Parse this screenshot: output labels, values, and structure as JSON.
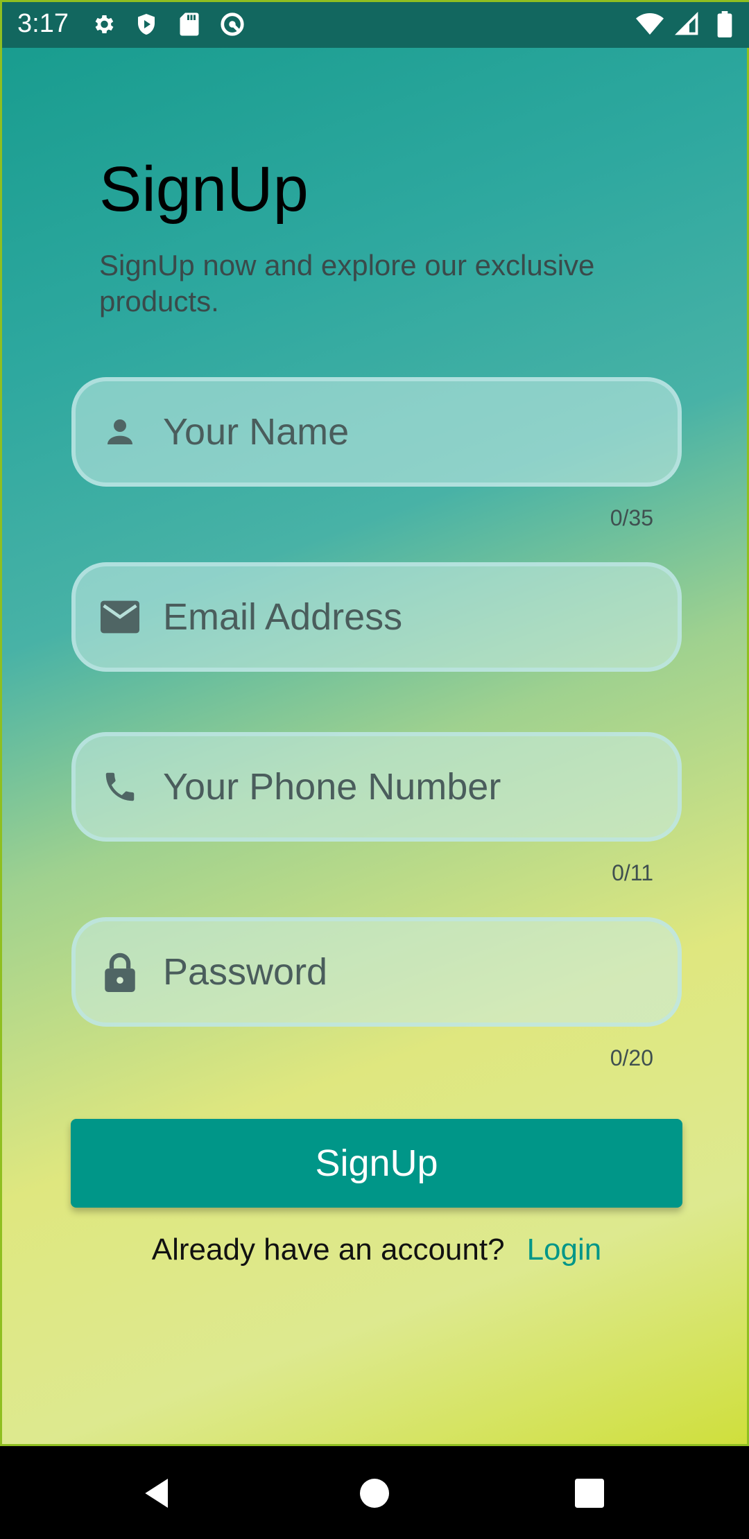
{
  "status_bar": {
    "time": "3:17",
    "left_icons": [
      "settings-icon",
      "shield-play-icon",
      "sd-card-icon",
      "sync-icon"
    ],
    "right_icons": [
      "wifi-icon",
      "signal-icon",
      "battery-icon"
    ]
  },
  "header": {
    "title": "SignUp",
    "subtitle": "SignUp now and explore our exclusive products."
  },
  "form": {
    "name": {
      "placeholder": "Your Name",
      "value": "",
      "counter": "0/35",
      "icon": "person-icon"
    },
    "email": {
      "placeholder": "Email Address",
      "value": "",
      "icon": "mail-icon"
    },
    "phone": {
      "placeholder": "Your Phone Number",
      "value": "",
      "counter": "0/11",
      "icon": "phone-icon"
    },
    "password": {
      "placeholder": "Password",
      "value": "",
      "counter": "0/20",
      "icon": "lock-icon"
    },
    "submit_label": "SignUp"
  },
  "footer": {
    "prompt": "Already have an account?",
    "login_label": "Login"
  },
  "colors": {
    "accent": "#009688",
    "status_bar": "#12675f"
  },
  "nav_bar": {
    "buttons": [
      "back-icon",
      "home-icon",
      "recents-icon"
    ]
  }
}
